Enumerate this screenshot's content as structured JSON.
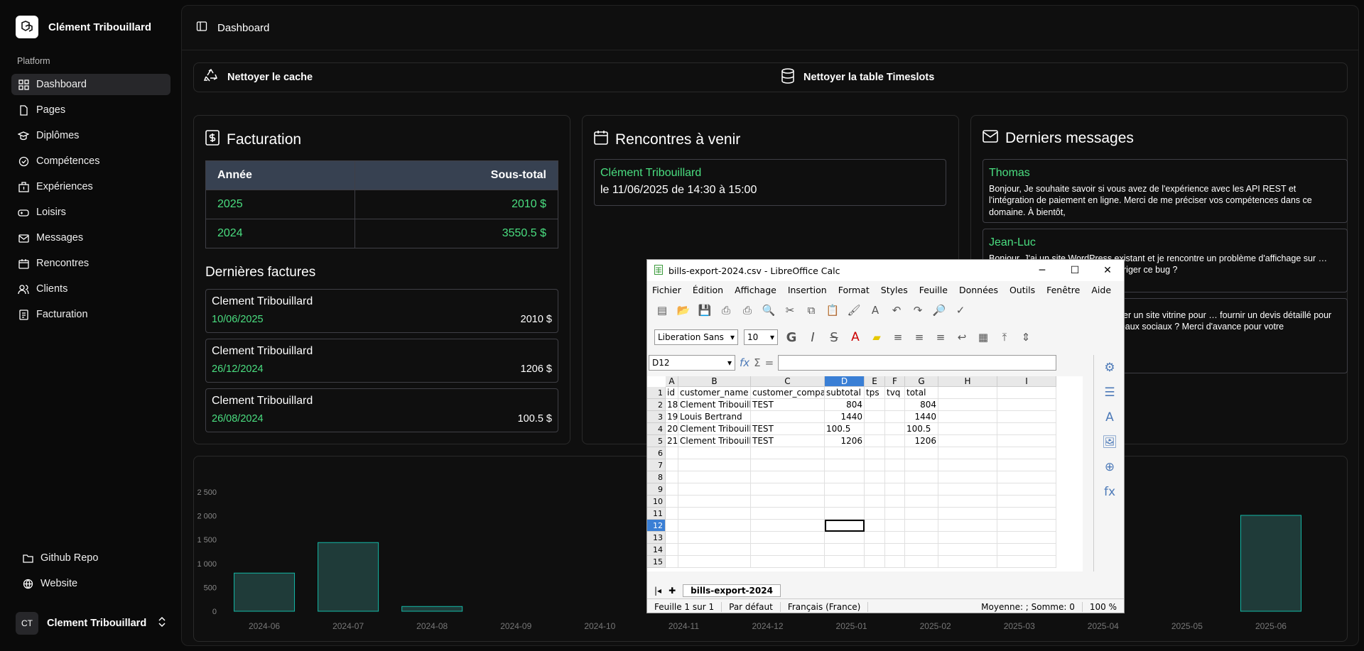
{
  "user": {
    "name": "Clément Tribouillard",
    "initials": "CT",
    "bottom_name": "Clement Tribouillard"
  },
  "sidebar": {
    "section": "Platform",
    "items": [
      {
        "label": "Dashboard",
        "icon": "grid-icon"
      },
      {
        "label": "Pages",
        "icon": "file-icon"
      },
      {
        "label": "Diplômes",
        "icon": "graduation-cap-icon"
      },
      {
        "label": "Compétences",
        "icon": "check-circle-icon"
      },
      {
        "label": "Expériences",
        "icon": "building-icon"
      },
      {
        "label": "Loisirs",
        "icon": "gamepad-icon"
      },
      {
        "label": "Messages",
        "icon": "mail-icon"
      },
      {
        "label": "Rencontres",
        "icon": "calendar-icon"
      },
      {
        "label": "Clients",
        "icon": "users-icon"
      },
      {
        "label": "Facturation",
        "icon": "receipt-icon"
      }
    ],
    "bottom": [
      {
        "label": "Github Repo",
        "icon": "folder-icon"
      },
      {
        "label": "Website",
        "icon": "globe-icon"
      }
    ]
  },
  "header": {
    "title": "Dashboard"
  },
  "actions": {
    "clear_cache": "Nettoyer le cache",
    "clear_timeslots": "Nettoyer la table Timeslots"
  },
  "billing": {
    "title": "Facturation",
    "col_year": "Année",
    "col_subtotal": "Sous-total",
    "rows": [
      {
        "year": "2025",
        "subtotal": "2010 $"
      },
      {
        "year": "2024",
        "subtotal": "3550.5 $"
      }
    ],
    "recent_title": "Dernières factures",
    "invoices": [
      {
        "name": "Clement Tribouillard",
        "date": "10/06/2025",
        "amount": "2010 $"
      },
      {
        "name": "Clement Tribouillard",
        "date": "26/12/2024",
        "amount": "1206 $"
      },
      {
        "name": "Clement Tribouillard",
        "date": "26/08/2024",
        "amount": "100.5 $"
      }
    ]
  },
  "meetings": {
    "title": "Rencontres à venir",
    "items": [
      {
        "name": "Clément Tribouillard",
        "date": "le 11/06/2025 de 14:30 à 15:00"
      }
    ]
  },
  "messages": {
    "title": "Derniers messages",
    "items": [
      {
        "name": "Thomas",
        "body": "Bonjour, Je souhaite savoir si vous avez de l'expérience avec les API REST et l'intégration de paiement en ligne. Merci de me préciser vos compétences dans ce domaine. À bientôt,"
      },
      {
        "name": "Jean-Luc",
        "body": "Bonjour, J'ai un site WordPress existant et je rencontre un problème d'affichage sur … une intervention rapide afin de corriger ce bug ?"
      },
      {
        "name": "",
        "body": "… développeur freelance pour créer un site vitrine pour … fournir un devis détaillé pour un site responsive avec … de réseaux sociaux ? Merci d'avance pour votre"
      }
    ]
  },
  "chart_data": {
    "type": "bar",
    "categories": [
      "2024-06",
      "2024-07",
      "2024-08",
      "2024-09",
      "2024-10",
      "2024-11",
      "2024-12",
      "2025-01",
      "2025-02",
      "2025-03",
      "2025-04",
      "2025-05",
      "2025-06"
    ],
    "values": [
      800,
      1440,
      100,
      0,
      0,
      0,
      0,
      0,
      0,
      0,
      0,
      0,
      2010
    ],
    "yticks": [
      "0",
      "500",
      "1 000",
      "1 500",
      "2 000",
      "2 500"
    ],
    "ylim": [
      0,
      2500
    ],
    "color": "#14b8a6"
  },
  "calc": {
    "title": "bills-export-2024.csv - LibreOffice Calc",
    "menu": [
      "Fichier",
      "Édition",
      "Affichage",
      "Insertion",
      "Format",
      "Styles",
      "Feuille",
      "Données",
      "Outils",
      "Fenêtre",
      "Aide"
    ],
    "font": "Liberation Sans",
    "size": "10",
    "cellref": "D12",
    "fx": "fx",
    "sum": "Σ",
    "eq": "=",
    "columns": [
      "A",
      "B",
      "C",
      "D",
      "E",
      "F",
      "G",
      "H",
      "I"
    ],
    "rows": [
      [
        "id",
        "customer_name",
        "customer_company",
        "subtotal",
        "tps",
        "tvq",
        "total",
        "",
        ""
      ],
      [
        "18",
        "Clement Tribouillard",
        "TEST",
        "804",
        "",
        "",
        "804",
        "",
        ""
      ],
      [
        "19",
        "Louis Bertrand",
        "",
        "1440",
        "",
        "",
        "1440",
        "",
        ""
      ],
      [
        "20",
        "Clement Tribouillard",
        "TEST",
        "100.5",
        "",
        "",
        "100.5",
        "",
        ""
      ],
      [
        "21",
        "Clement Tribouillard",
        "TEST",
        "1206",
        "",
        "",
        "1206",
        "",
        ""
      ]
    ],
    "row_numbers": [
      "1",
      "2",
      "3",
      "4",
      "5",
      "6",
      "7",
      "8",
      "9",
      "10",
      "11",
      "12",
      "13",
      "14",
      "15"
    ],
    "sheet_tab": "bills-export-2024",
    "status": {
      "sheet": "Feuille 1 sur 1",
      "style": "Par défaut",
      "lang": "Français (France)",
      "stats": "Moyenne: ; Somme: 0",
      "zoom": "100 %"
    }
  }
}
